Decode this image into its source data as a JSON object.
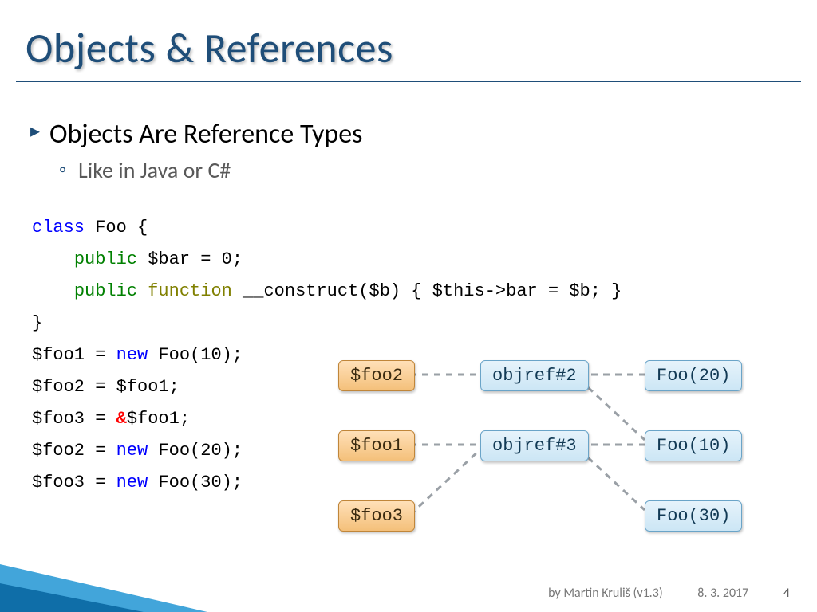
{
  "title": "Objects & References",
  "bullets": {
    "b1": "Objects Are Reference Types",
    "b2": "Like in Java or C#"
  },
  "code": {
    "kw_class": "class",
    "classname": " Foo {",
    "kw_public1": "public",
    "bar_decl": " $bar = 0;",
    "kw_public2": "public",
    "kw_function": " function",
    "ctor_rest": " __construct($b) { $this->bar = $b; }",
    "close": "}",
    "stmt1a": "$foo1 = ",
    "kw_new1": "new",
    "stmt1b": " Foo(10);",
    "stmt2": "$foo2 = $foo1;",
    "stmt3a": "$foo3 = ",
    "amp": "&",
    "stmt3b": "$foo1;",
    "stmt4a": "$foo2 = ",
    "kw_new2": "new",
    "stmt4b": " Foo(20);",
    "stmt5a": "$foo3 = ",
    "kw_new3": "new",
    "stmt5b": " Foo(30);"
  },
  "boxes": {
    "foo2": "$foo2",
    "foo1": "$foo1",
    "foo3": "$foo3",
    "objref2": "objref#2",
    "objref3": "objref#3",
    "Foo20": "Foo(20)",
    "Foo10": "Foo(10)",
    "Foo30": "Foo(30)"
  },
  "footer": {
    "author": "by Martin Kruliš (v1.3)",
    "date": "8. 3. 2017",
    "page": "4"
  }
}
